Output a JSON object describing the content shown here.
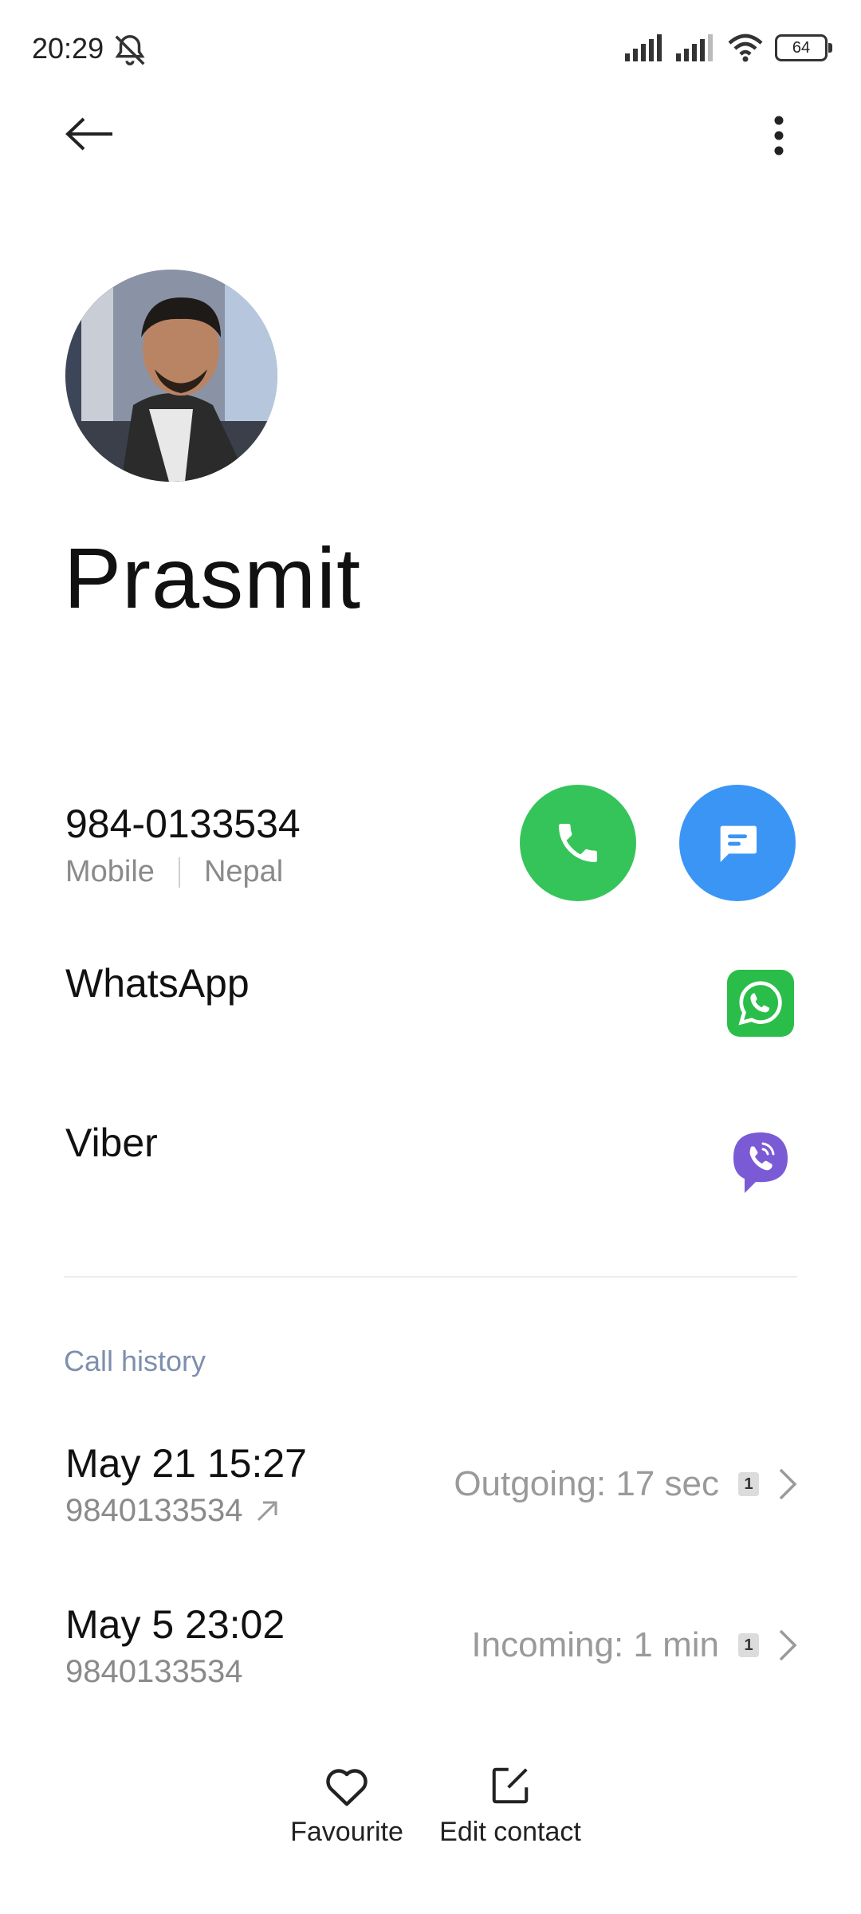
{
  "status_bar": {
    "time": "20:29",
    "battery": "64"
  },
  "contact": {
    "name": "Prasmit"
  },
  "phone": {
    "number": "984-0133534",
    "type": "Mobile",
    "region": "Nepal"
  },
  "apps": [
    {
      "label": "WhatsApp"
    },
    {
      "label": "Viber"
    }
  ],
  "call_history": {
    "title": "Call history",
    "entries": [
      {
        "date": "May 21 15:27",
        "number": "9840133534",
        "info": "Outgoing: 17 sec",
        "sim": "1",
        "direction": "outgoing"
      },
      {
        "date": "May 5 23:02",
        "number": "9840133534",
        "info": "Incoming: 1 min",
        "sim": "1",
        "direction": "incoming"
      }
    ]
  },
  "bottom": {
    "favourite_label": "Favourite",
    "edit_label": "Edit contact"
  },
  "colors": {
    "call_green": "#35c45a",
    "message_blue": "#3b95f5",
    "whatsapp_green": "#2bbd4a",
    "viber_purple": "#7b5ad6",
    "section_title": "#7e8fae"
  }
}
